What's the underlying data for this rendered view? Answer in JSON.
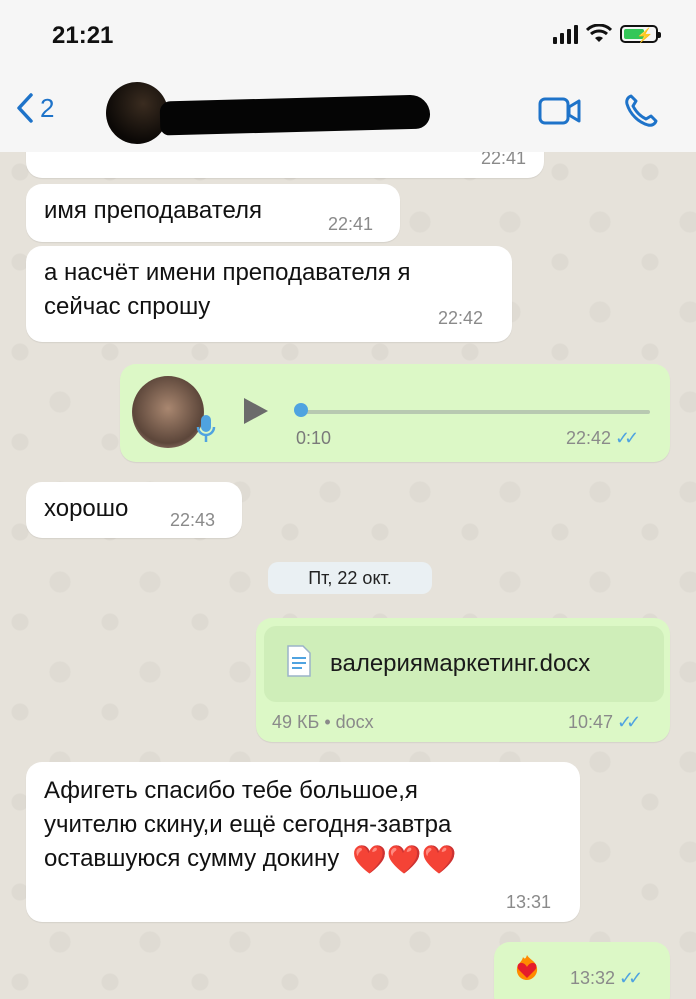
{
  "status": {
    "time": "21:21"
  },
  "header": {
    "back_count": "2"
  },
  "messages": [
    {
      "time": "22:41"
    },
    {
      "text": "имя преподавателя",
      "time": "22:41"
    },
    {
      "line1": "а насчёт имени преподавателя я",
      "line2": "сейчас спрошу",
      "time": "22:42"
    },
    {
      "duration": "0:10",
      "time": "22:42"
    },
    {
      "text": "хорошо",
      "time": "22:43"
    }
  ],
  "date_separator": "Пт, 22 окт.",
  "document": {
    "file_name": "валериямаркетинг.docx",
    "info": "49 КБ • docx",
    "time": "10:47"
  },
  "long_message": {
    "line1": "Афигеть спасибо тебе большое,я",
    "line2": "учителю скину,и ещё сегодня-завтра",
    "line3": "оставшуюся сумму докину",
    "hearts": "❤️❤️❤️",
    "time": "13:31"
  },
  "last_message": {
    "time": "13:32"
  },
  "colors": {
    "incoming": "#ffffff",
    "outgoing": "#dcf8c6",
    "accent": "#1e73c9",
    "read_checks": "#4fa3e0"
  }
}
